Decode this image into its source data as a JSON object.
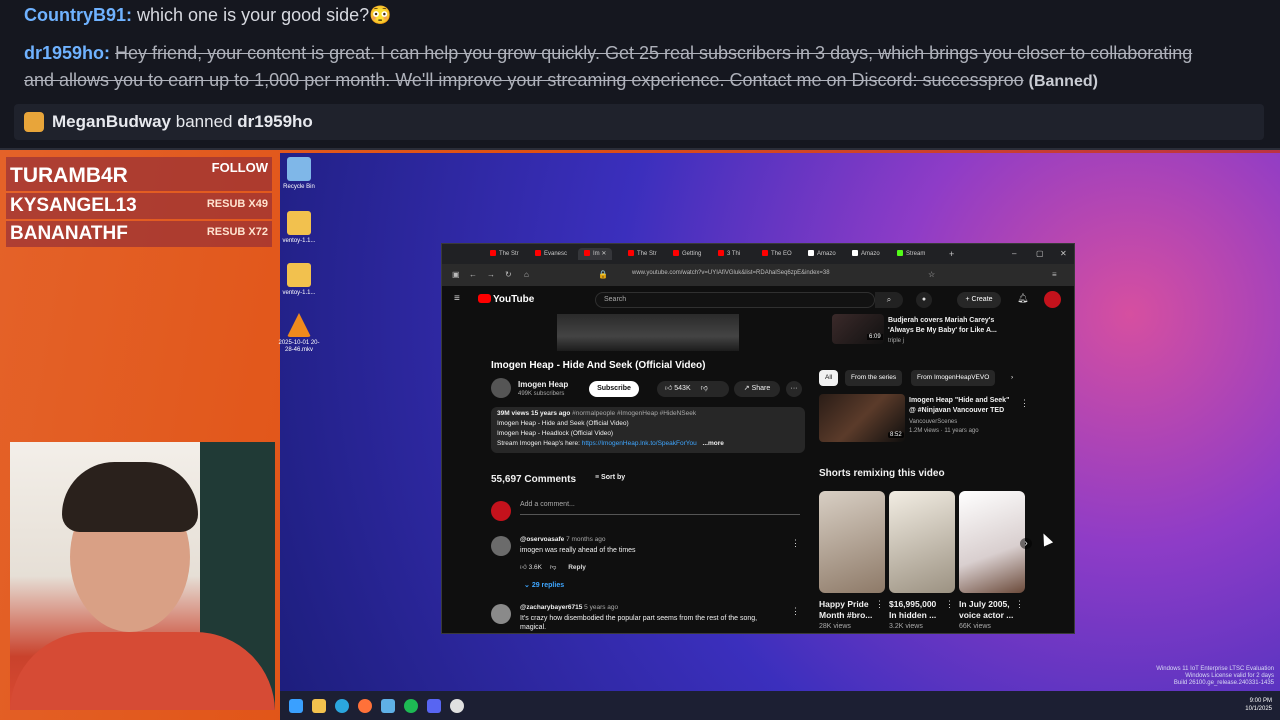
{
  "chat": {
    "line1": {
      "user": "CountryB91",
      "text": " which one is your good side?😳"
    },
    "line2": {
      "user": "dr1959ho",
      "text1": "Hey friend, your content is great. I can help you grow quickly. Get 25 real subscribers in 3 days, which brings you closer to collaborating",
      "text2": "and allows you to earn up to 1,000 per month. We'll improve your streaming experience. Contact me on Discord: successproo",
      "tag": "(Banned)"
    },
    "modaction": {
      "moderator": "MeganBudway",
      "action": "banned",
      "target": "dr1959ho"
    }
  },
  "sidepanel": {
    "follow_label": "FOLLOW",
    "rows": [
      {
        "name": "TURAMB4R",
        "tag": ""
      },
      {
        "name": "KYSANGEL13",
        "tag": "RESUB X49"
      },
      {
        "name": "BANANATHF",
        "tag": "RESUB X72"
      }
    ]
  },
  "desktop": {
    "icons": [
      {
        "label": "Recycle Bin",
        "icon": "recycle-bin-icon",
        "color": "#7fb7e8"
      },
      {
        "label": "ventoy-1.1...",
        "icon": "folder-icon",
        "color": "#f2c14e"
      },
      {
        "label": "ventoy-1.1...",
        "icon": "folder-icon",
        "color": "#f2c14e"
      },
      {
        "label": "2025-10-01 20-28-46.mkv",
        "icon": "vlc-icon",
        "color": "#f08a1d"
      }
    ],
    "wininfo": [
      "Windows 11 IoT Enterprise LTSC Evaluation",
      "Windows License valid for 2 days",
      "Build 26100.ge_release.240331-1435"
    ]
  },
  "taskbar": {
    "time": "9:00 PM",
    "date": "10/1/2025",
    "icons": [
      {
        "name": "start-icon",
        "color": "#3aa0ff"
      },
      {
        "name": "file-explorer-icon",
        "color": "#f2c14e"
      },
      {
        "name": "edge-icon",
        "color": "#2ba6de"
      },
      {
        "name": "firefox-icon",
        "color": "#ff7139"
      },
      {
        "name": "app-icon",
        "color": "#5fb0e6"
      },
      {
        "name": "spotify-icon",
        "color": "#1db954"
      },
      {
        "name": "discord-icon",
        "color": "#5865f2"
      },
      {
        "name": "obs-icon",
        "color": "#e0e0e0"
      }
    ]
  },
  "browser": {
    "tabs": [
      "The Str",
      "Evanesc",
      "Im",
      "The Str",
      "Getting",
      "3 Thi",
      "The EO",
      "Amazo",
      "Amazo",
      "Stream"
    ],
    "url": "www.youtube.com/watch?v=UYIAfiVGluk&list=RDAhalSeq6zpE&index=38"
  },
  "youtube": {
    "logo": "YouTube",
    "search_placeholder": "Search",
    "create_label": "Create",
    "video_title": "Imogen Heap - Hide And Seek (Official Video)",
    "channel": "Imogen Heap",
    "subs": "499K subscribers",
    "subscribe_label": "Subscribe",
    "likes": "543K",
    "share_label": "Share",
    "desc_meta": "39M views  15 years ago",
    "desc_tags": "#normalpeople #ImogenHeap #HideNSeek",
    "desc_line2": "Imogen Heap - Hide and Seek (Official Video)",
    "desc_line3": "Imogen Heap - Headlock (Official Video)",
    "desc_line4_pre": "Stream Imogen Heap's here: ",
    "desc_link": "https://ImogenHeap.lnk.to/SpeakForYou",
    "desc_more": "...more",
    "comment_count": "55,697 Comments",
    "sort_label": "Sort by",
    "add_comment": "Add a comment...",
    "comments": [
      {
        "user": "@oservoasafe",
        "time": "7 months ago",
        "text": "imogen was really ahead of the times",
        "likes": "3.6K",
        "reply": "Reply",
        "replies": "29 replies"
      },
      {
        "user": "@zacharybayer6715",
        "time": "5 years ago",
        "text": "It's crazy how disembodied the popular part seems from the rest of the song,",
        "text2": "magical."
      }
    ],
    "rec_top": {
      "title1": "Budjerah covers Mariah Carey's",
      "title2": "'Always Be My Baby' for Like A...",
      "meta": "triple j",
      "dur": "6:09"
    },
    "chips": [
      "All",
      "From the series",
      "From ImogenHeapVEVO"
    ],
    "rec1": {
      "title1": "Imogen Heap \"Hide and Seek\"",
      "title2": "@ #Ninjavan Vancouver TED",
      "channel": "VancouverScenes",
      "meta": "1.2M views · 11 years ago",
      "dur": "8:52"
    },
    "shorts_title": "Shorts remixing this video",
    "shorts": [
      {
        "title1": "Happy Pride",
        "title2": "Month #bro...",
        "views": "28K views",
        "color": "#b9a48c"
      },
      {
        "title1": "$16,995,000",
        "title2": "In hidden ...",
        "views": "3.2K views",
        "color": "#cfc6b5"
      },
      {
        "title1": "In July 2005,",
        "title2": "voice actor ...",
        "views": "66K views",
        "color": "#e8e4e4"
      }
    ]
  }
}
